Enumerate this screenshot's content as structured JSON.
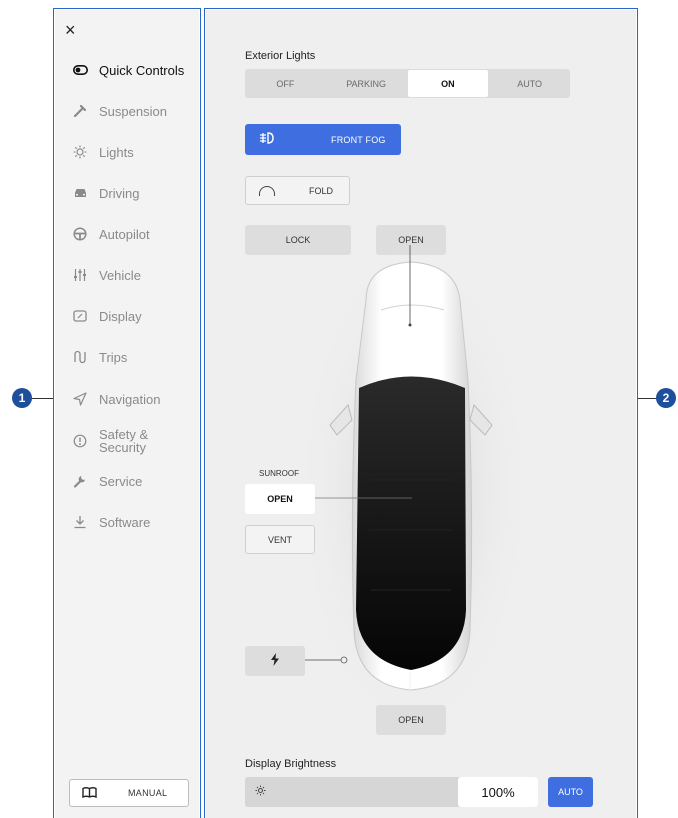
{
  "sidebar": {
    "close_icon": "×",
    "items": [
      {
        "label": "Quick Controls",
        "icon": "toggle-icon",
        "active": true
      },
      {
        "label": "Suspension",
        "icon": "wrench-icon"
      },
      {
        "label": "Lights",
        "icon": "light-icon"
      },
      {
        "label": "Driving",
        "icon": "car-icon"
      },
      {
        "label": "Autopilot",
        "icon": "steering-wheel-icon"
      },
      {
        "label": "Vehicle",
        "icon": "sliders-icon"
      },
      {
        "label": "Display",
        "icon": "display-icon"
      },
      {
        "label": "Trips",
        "icon": "trips-icon"
      },
      {
        "label": "Navigation",
        "icon": "navigation-icon"
      },
      {
        "label": "Safety &",
        "label2": "Security",
        "icon": "alert-icon"
      },
      {
        "label": "Service",
        "icon": "service-wrench-icon"
      },
      {
        "label": "Software",
        "icon": "download-icon"
      }
    ],
    "manual_label": "MANUAL"
  },
  "callouts": {
    "left": "1",
    "right": "2"
  },
  "main": {
    "exterior_lights_label": "Exterior Lights",
    "exterior_lights_options": [
      "OFF",
      "PARKING",
      "ON",
      "AUTO"
    ],
    "exterior_lights_selected": "ON",
    "front_fog_label": "FRONT FOG",
    "front_fog_on": true,
    "fold_label": "FOLD",
    "lock_label": "LOCK",
    "frunk_label": "OPEN",
    "sunroof_label": "SUNROOF",
    "sunroof_open_label": "OPEN",
    "sunroof_vent_label": "VENT",
    "charge_icon": "⚡",
    "trunk_label": "OPEN",
    "brightness_label": "Display Brightness",
    "brightness_value": "100%",
    "brightness_level": 1.0,
    "brightness_auto_label": "AUTO"
  },
  "colors": {
    "accent": "#3e6ee0",
    "frame": "#2a66c9",
    "callout": "#1d4f9c"
  }
}
